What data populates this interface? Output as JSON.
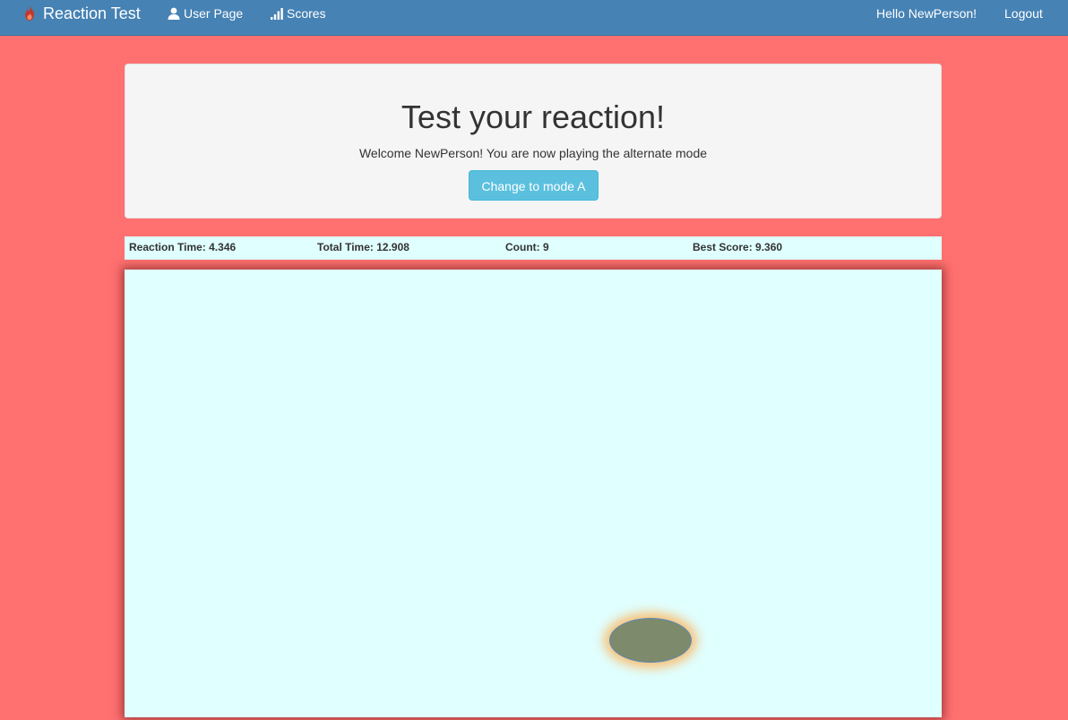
{
  "navbar": {
    "brand": "Reaction Test",
    "brand_icon": "fire-icon",
    "links": [
      {
        "label": "User Page",
        "icon": "user-icon"
      },
      {
        "label": "Scores",
        "icon": "signal-bars-icon"
      }
    ],
    "greeting": "Hello NewPerson!",
    "logout": "Logout",
    "color": "#4682b4"
  },
  "header": {
    "title": "Test your reaction!",
    "subtitle": "Welcome NewPerson! You are now playing the alternate mode",
    "mode_button": "Change to mode A"
  },
  "stats": {
    "reaction_time": "Reaction Time: 4.346",
    "total_time": "Total Time: 12.908",
    "count": "Count: 9",
    "best_score": "Best Score: 9.360"
  },
  "game": {
    "background": "#e0ffff",
    "target_color": "#7d8a6c",
    "target_glow": "#ffaf50"
  },
  "page_background": "#ff7070"
}
